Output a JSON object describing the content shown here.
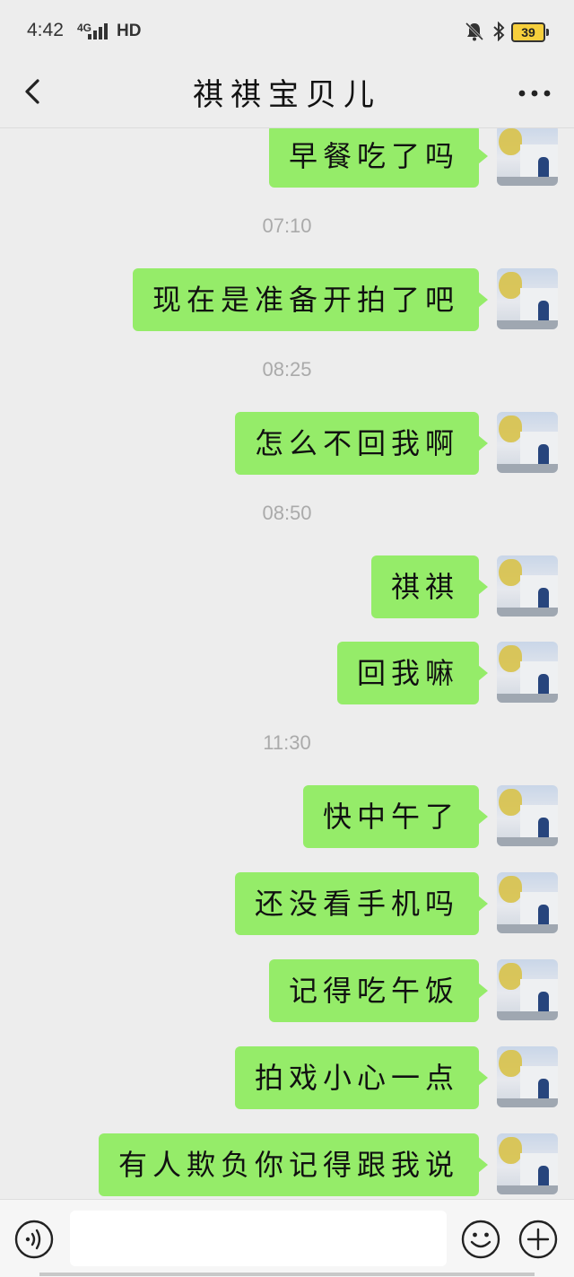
{
  "status_bar": {
    "time": "4:42",
    "network": "4G",
    "hd": "HD",
    "battery": "39"
  },
  "header": {
    "title": "祺祺宝贝儿",
    "back_icon": "chevron-left-icon",
    "more_icon": "more-dots-icon"
  },
  "messages": [
    {
      "type": "message",
      "text": "早餐吃了吗"
    },
    {
      "type": "time",
      "text": "07:10"
    },
    {
      "type": "message",
      "text": "现在是准备开拍了吧"
    },
    {
      "type": "time",
      "text": "08:25"
    },
    {
      "type": "message",
      "text": "怎么不回我啊"
    },
    {
      "type": "time",
      "text": "08:50"
    },
    {
      "type": "message",
      "text": "祺祺"
    },
    {
      "type": "message",
      "text": "回我嘛"
    },
    {
      "type": "time",
      "text": "11:30"
    },
    {
      "type": "message",
      "text": "快中午了"
    },
    {
      "type": "message",
      "text": "还没看手机吗"
    },
    {
      "type": "message",
      "text": "记得吃午饭"
    },
    {
      "type": "message",
      "text": "拍戏小心一点"
    },
    {
      "type": "message",
      "text": "有人欺负你记得跟我说"
    }
  ],
  "input_bar": {
    "voice_icon": "voice-icon",
    "input_value": "",
    "emoji_icon": "emoji-icon",
    "plus_icon": "plus-icon"
  },
  "colors": {
    "bubble": "#95ec69",
    "background": "#ededed",
    "timestamp": "#aaaaaa"
  }
}
